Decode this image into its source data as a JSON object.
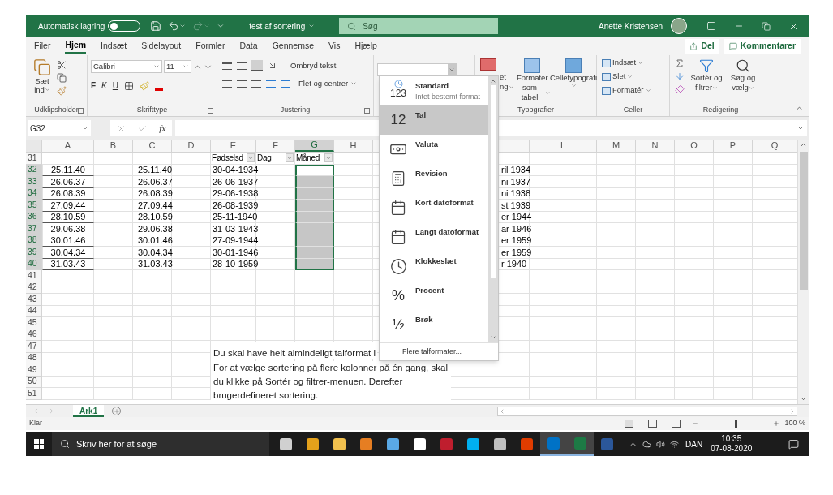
{
  "title_bar": {
    "autosave_label": "Automatisk lagring",
    "autosave_on": false,
    "document": "test af sortering",
    "search_placeholder": "Søg",
    "user": "Anette Kristensen"
  },
  "ribbon_tabs": [
    {
      "label": "Filer",
      "selected": false
    },
    {
      "label": "Hjem",
      "selected": true
    },
    {
      "label": "Indsæt",
      "selected": false
    },
    {
      "label": "Sidelayout",
      "selected": false
    },
    {
      "label": "Formler",
      "selected": false
    },
    {
      "label": "Data",
      "selected": false
    },
    {
      "label": "Gennemse",
      "selected": false
    },
    {
      "label": "Vis",
      "selected": false
    },
    {
      "label": "Hjælp",
      "selected": false
    }
  ],
  "share_button": "Del",
  "comments_button": "Kommentarer",
  "clipboard": {
    "paste_line_1": "Sæt",
    "paste_line_2": "ind",
    "group": "Udklipsholder"
  },
  "font": {
    "name": "Calibri",
    "size": "11",
    "bold": "F",
    "italic": "K",
    "underline": "U",
    "group": "Skrifttype"
  },
  "alignment": {
    "wrap": "Ombryd tekst",
    "merge": "Flet og centrer",
    "group": "Justering"
  },
  "styles": {
    "conditional_line_1": "et",
    "conditional_line_2": "ng",
    "format_table_line_1": "Formatér",
    "format_table_line_2": "som tabel",
    "cell_styles": "Celletypografi",
    "group": "Typografier"
  },
  "cells": {
    "items": [
      "Indsæt",
      "Slet",
      "Formatér"
    ],
    "group": "Celler"
  },
  "editing": {
    "sort_line_1": "Sortér og",
    "sort_line_2": "filtrer",
    "find_line_1": "Søg og",
    "find_line_2": "vælg",
    "group": "Redigering"
  },
  "formula_bar": {
    "name_box": "G32",
    "function_label": "fx"
  },
  "columns_left": [
    {
      "label": "A",
      "selected": false
    },
    {
      "label": "B",
      "selected": false
    },
    {
      "label": "C",
      "selected": false
    },
    {
      "label": "D",
      "selected": false
    },
    {
      "label": "E",
      "selected": false
    },
    {
      "label": "F",
      "selected": false
    },
    {
      "label": "G",
      "selected": true
    },
    {
      "label": "H",
      "selected": false
    }
  ],
  "columns_right": [
    {
      "label": "L",
      "selected": false
    },
    {
      "label": "M",
      "selected": false
    },
    {
      "label": "N",
      "selected": false
    },
    {
      "label": "O",
      "selected": false
    },
    {
      "label": "P",
      "selected": false
    },
    {
      "label": "Q",
      "selected": false
    }
  ],
  "header_row": {
    "row": "31",
    "filters": [
      "Fødselsd",
      "Dag",
      "Måned"
    ]
  },
  "data_rows": [
    {
      "row": "32",
      "a": "25.11.40",
      "c": "25.11.40",
      "e": "30-04-1934",
      "k": "ril 1934",
      "selected": true,
      "active": true
    },
    {
      "row": "33",
      "a": "26.06.37",
      "c": "26.06.37",
      "e": "26-06-1937",
      "k": "ni 1937",
      "selected": true,
      "active": false
    },
    {
      "row": "34",
      "a": "26.08.39",
      "c": "26.08.39",
      "e": "29-06-1938",
      "k": "ni 1938",
      "selected": true,
      "active": false
    },
    {
      "row": "35",
      "a": "27.09.44",
      "c": "27.09.44",
      "e": "26-08-1939",
      "k": "st 1939",
      "selected": true,
      "active": false
    },
    {
      "row": "36",
      "a": "28.10.59",
      "c": "28.10.59",
      "e": "25-11-1940",
      "k": "er 1944",
      "selected": true,
      "active": false
    },
    {
      "row": "37",
      "a": "29.06.38",
      "c": "29.06.38",
      "e": "31-03-1943",
      "k": "ar 1946",
      "selected": true,
      "active": false
    },
    {
      "row": "38",
      "a": "30.01.46",
      "c": "30.01.46",
      "e": "27-09-1944",
      "k": "er 1959",
      "selected": true,
      "active": false
    },
    {
      "row": "39",
      "a": "30.04.34",
      "c": "30.04.34",
      "e": "30-01-1946",
      "k": "er 1959",
      "selected": true,
      "active": false
    },
    {
      "row": "40",
      "a": "31.03.43",
      "c": "31.03.43",
      "e": "28-10-1959",
      "k": "r 1940",
      "selected": true,
      "active": false
    }
  ],
  "empty_rows": [
    "41",
    "42",
    "43",
    "44",
    "45",
    "46",
    "47",
    "48",
    "49",
    "50",
    "51"
  ],
  "text_box": {
    "lines": [
      "Du skal have helt almindeligt talformat i",
      "For at vælge sortering på flere kolonner på én gang, skal",
      "du klikke på Sortér og filtrer-menuen. Derefter",
      "brugerdefineret sortering."
    ]
  },
  "number_format_menu": {
    "items": [
      {
        "kind": "general",
        "label": "Standard",
        "sub": "Intet bestemt format",
        "icon_text": "123",
        "selected": false
      },
      {
        "kind": "number",
        "label": "Tal",
        "icon_text": "12",
        "selected": true
      },
      {
        "kind": "currency",
        "label": "Valuta",
        "selected": false
      },
      {
        "kind": "accounting",
        "label": "Revision",
        "selected": false
      },
      {
        "kind": "short_date",
        "label": "Kort datoformat",
        "selected": false
      },
      {
        "kind": "long_date",
        "label": "Langt datoformat",
        "selected": false
      },
      {
        "kind": "time",
        "label": "Klokkeslæt",
        "selected": false
      },
      {
        "kind": "percent",
        "label": "Procent",
        "icon_text": "%",
        "selected": false
      },
      {
        "kind": "fraction",
        "label": "Brøk",
        "icon_text": "½",
        "selected": false
      }
    ],
    "footer": "Flere talformater..."
  },
  "sheet_tabs": [
    {
      "label": "Ark1",
      "selected": true
    }
  ],
  "status_bar": {
    "status": "Klar",
    "zoom": "100 %",
    "zoom_level": {
      "level": 0.5
    }
  },
  "taskbar": {
    "search_placeholder": "Skriv her for at søge",
    "apps": [
      {
        "color": "#d0d0d0",
        "active": false
      },
      {
        "color": "#e4a11b",
        "active": false
      },
      {
        "color": "#f2c14e",
        "active": false
      },
      {
        "color": "#e67e22",
        "active": false
      },
      {
        "color": "#5aa9e6",
        "active": false
      },
      {
        "color": "#ffffff",
        "active": false
      },
      {
        "color": "#bf1e2e",
        "active": false
      },
      {
        "color": "#00aff0",
        "active": false
      },
      {
        "color": "#c0c0c0",
        "active": false
      },
      {
        "color": "#e03c00",
        "active": false
      },
      {
        "color": "#0072c6",
        "active": true
      },
      {
        "color": "#1d7a45",
        "active": true
      },
      {
        "color": "#2b579a",
        "active": false
      }
    ],
    "language": "DAN",
    "time": "10:35",
    "date": "07-08-2020"
  }
}
